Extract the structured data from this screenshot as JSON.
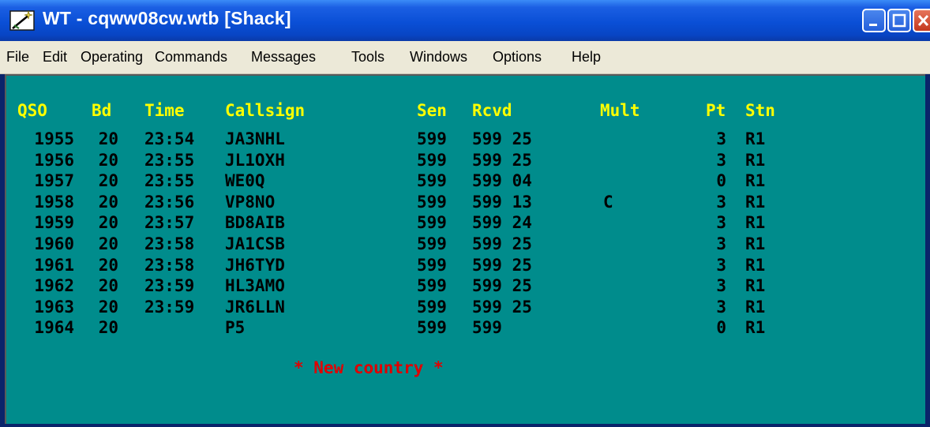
{
  "window": {
    "title": "WT - cqww08cw.wtb [Shack]",
    "app_icon": "antenna-wand-icon",
    "buttons": [
      "minimize-icon",
      "maximize-icon",
      "close-icon"
    ]
  },
  "menu": [
    "File",
    "Edit",
    "Operating",
    "Commands",
    "Messages",
    "Tools",
    "Windows",
    "Options",
    "Help"
  ],
  "log": {
    "headers": {
      "qso": "QSO",
      "bd": "Bd",
      "time": "Time",
      "call": "Callsign",
      "sen": "Sen",
      "rcvd": "Rcvd",
      "mult": "Mult",
      "pt": "Pt",
      "stn": "Stn"
    },
    "rows": [
      {
        "qso": "1955",
        "bd": "20",
        "time": "23:54",
        "call": "JA3NHL",
        "sen": "599",
        "rcvd": "599 25",
        "mult": "",
        "pt": "3",
        "stn": "R1"
      },
      {
        "qso": "1956",
        "bd": "20",
        "time": "23:55",
        "call": "JL1OXH",
        "sen": "599",
        "rcvd": "599 25",
        "mult": "",
        "pt": "3",
        "stn": "R1"
      },
      {
        "qso": "1957",
        "bd": "20",
        "time": "23:55",
        "call": "WE0Q",
        "sen": "599",
        "rcvd": "599 04",
        "mult": "",
        "pt": "0",
        "stn": "R1"
      },
      {
        "qso": "1958",
        "bd": "20",
        "time": "23:56",
        "call": "VP8NO",
        "sen": "599",
        "rcvd": "599 13",
        "mult": "C",
        "pt": "3",
        "stn": "R1"
      },
      {
        "qso": "1959",
        "bd": "20",
        "time": "23:57",
        "call": "BD8AIB",
        "sen": "599",
        "rcvd": "599 24",
        "mult": "",
        "pt": "3",
        "stn": "R1"
      },
      {
        "qso": "1960",
        "bd": "20",
        "time": "23:58",
        "call": "JA1CSB",
        "sen": "599",
        "rcvd": "599 25",
        "mult": "",
        "pt": "3",
        "stn": "R1"
      },
      {
        "qso": "1961",
        "bd": "20",
        "time": "23:58",
        "call": "JH6TYD",
        "sen": "599",
        "rcvd": "599 25",
        "mult": "",
        "pt": "3",
        "stn": "R1"
      },
      {
        "qso": "1962",
        "bd": "20",
        "time": "23:59",
        "call": "HL3AMO",
        "sen": "599",
        "rcvd": "599 25",
        "mult": "",
        "pt": "3",
        "stn": "R1"
      },
      {
        "qso": "1963",
        "bd": "20",
        "time": "23:59",
        "call": "JR6LLN",
        "sen": "599",
        "rcvd": "599 25",
        "mult": "",
        "pt": "3",
        "stn": "R1"
      },
      {
        "qso": "1964",
        "bd": "20",
        "time": "",
        "call": "P5",
        "sen": "599",
        "rcvd": "599",
        "mult": "",
        "pt": "0",
        "stn": "R1"
      }
    ],
    "message": "* New country *"
  },
  "colors": {
    "log_background": "#008c8c",
    "header_text": "#ffff00",
    "row_text": "#000000",
    "message_text": "#e00000"
  }
}
